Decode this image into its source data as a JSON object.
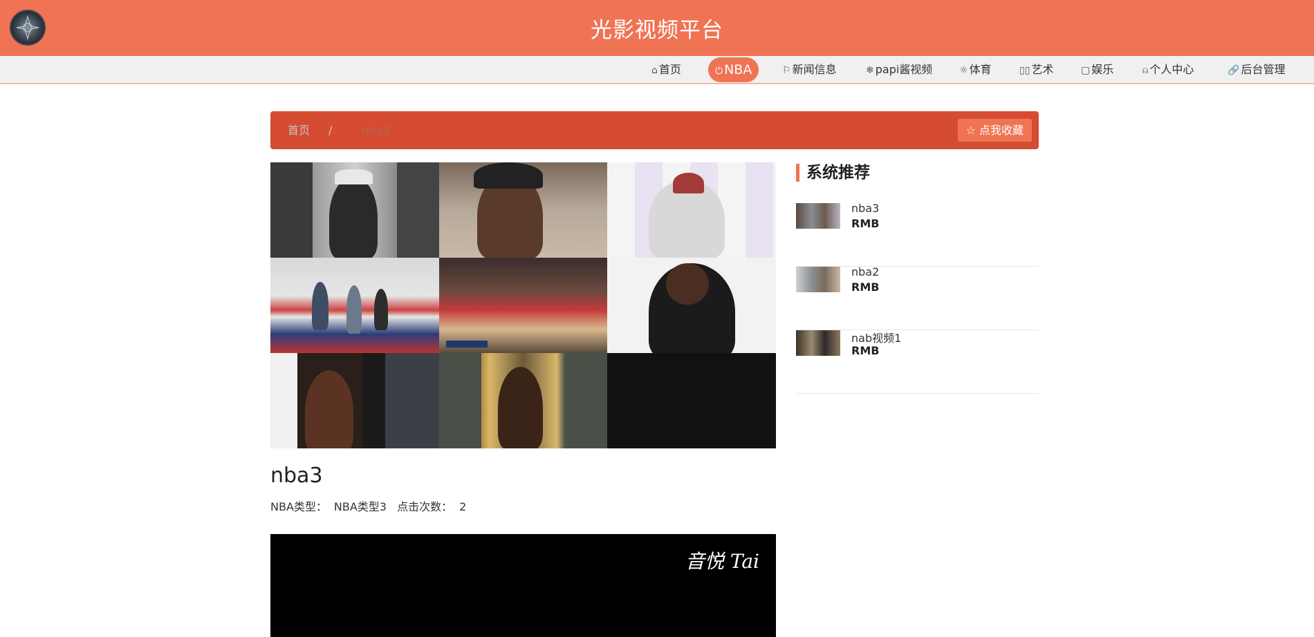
{
  "header": {
    "site_title": "光影视频平台",
    "brand_color": "#f07353"
  },
  "nav": {
    "items": [
      {
        "icon": "home-icon",
        "label": "首页"
      },
      {
        "icon": "power-icon",
        "label": "NBA",
        "active": true
      },
      {
        "icon": "flag-icon",
        "label": "新闻信息"
      },
      {
        "icon": "snowflake-icon",
        "label": "papi酱视频"
      },
      {
        "icon": "sun-icon",
        "label": "体育"
      },
      {
        "icon": "columns-icon",
        "label": "艺术"
      },
      {
        "icon": "note-icon",
        "label": "娱乐"
      },
      {
        "icon": "user-icon",
        "label": "个人中心"
      },
      {
        "icon": "link-icon",
        "label": "后台管理"
      }
    ]
  },
  "breadcrumb": {
    "home": "首页",
    "separator": "/",
    "current": "nba3",
    "favorite_label": "点我收藏"
  },
  "video": {
    "title": "nba3",
    "type_label": "NBA类型：",
    "type_value": "NBA类型3",
    "clicks_label": "点击次数：",
    "clicks_value": "2",
    "watermark": "音悦 Tai"
  },
  "sidebar": {
    "heading": "系统推荐",
    "items": [
      {
        "name": "nba3",
        "price": "RMB"
      },
      {
        "name": "nba2",
        "price": "RMB"
      },
      {
        "name": "nab视频1",
        "price": "RMB"
      }
    ]
  }
}
